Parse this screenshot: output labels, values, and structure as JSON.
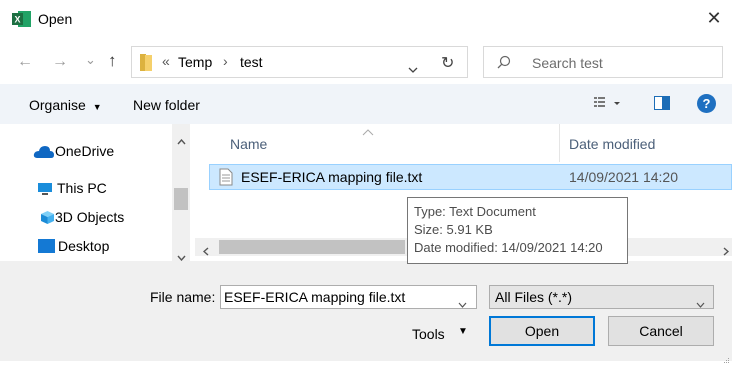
{
  "window": {
    "title": "Open",
    "close_glyph": "✕"
  },
  "nav": {
    "back_glyph": "←",
    "forward_glyph": "→",
    "recent_glyph": "⌄",
    "up_glyph": "↑",
    "breadcrumb_overflow": "«",
    "breadcrumb": [
      "Temp",
      "test"
    ],
    "breadcrumb_sep": "›",
    "refresh_glyph": "↻",
    "search_placeholder": "Search test"
  },
  "toolbar": {
    "organise": "Organise",
    "new_folder": "New folder",
    "help": "?"
  },
  "sidebar": {
    "items": [
      {
        "label": "OneDrive",
        "icon": "cloud-icon"
      },
      {
        "label": "This PC",
        "icon": "computer-icon"
      },
      {
        "label": "3D Objects",
        "icon": "cube-icon"
      },
      {
        "label": "Desktop",
        "icon": "desktop-icon"
      }
    ]
  },
  "filelist": {
    "columns": {
      "name": "Name",
      "date": "Date modified"
    },
    "rows": [
      {
        "name": "ESEF-ERICA mapping file.txt",
        "date": "14/09/2021 14:20",
        "selected": true
      }
    ]
  },
  "tooltip": {
    "type": "Type: Text Document",
    "size": "Size: 5.91 KB",
    "modified": "Date modified: 14/09/2021 14:20"
  },
  "bottom": {
    "file_name_label": "File name:",
    "file_name_value": "ESEF-ERICA mapping file.txt",
    "filter_value": "All Files (*.*)",
    "tools": "Tools",
    "open": "Open",
    "cancel": "Cancel"
  },
  "colors": {
    "selection": "#cce8ff",
    "selection_border": "#99d1ff",
    "accent": "#0078d7",
    "excel": "#1d6f42"
  }
}
